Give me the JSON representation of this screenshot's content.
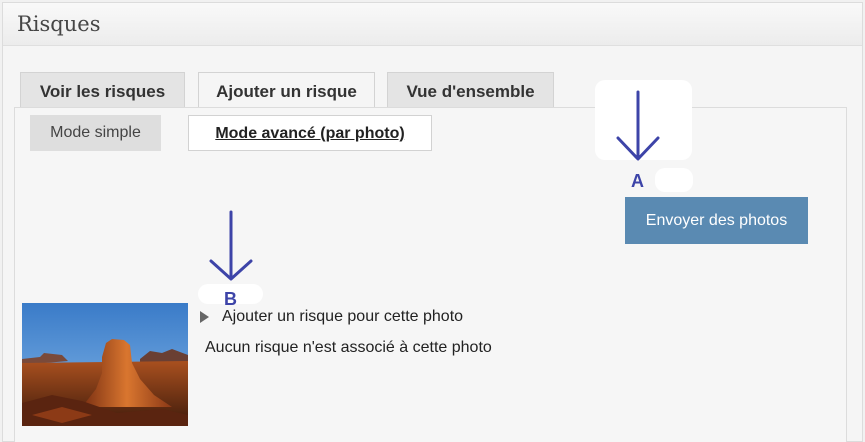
{
  "panel": {
    "title": "Risques"
  },
  "tabs": [
    {
      "label": "Voir les risques",
      "active": false
    },
    {
      "label": "Ajouter un risque",
      "active": true
    },
    {
      "label": "Vue d'ensemble",
      "active": false
    }
  ],
  "modes": {
    "simple_label": "Mode simple",
    "advanced_label": "Mode avancé (par photo)"
  },
  "upload": {
    "button_label": "Envoyer des photos"
  },
  "photo_item": {
    "add_risk_label": "Ajouter un risque pour cette photo",
    "no_risk_text": "Aucun risque n'est associé à cette photo"
  },
  "annotations": {
    "a_label": "A",
    "b_label": "B",
    "color": "#3d44a8"
  },
  "colors": {
    "accent_button": "#5a8ab2"
  }
}
